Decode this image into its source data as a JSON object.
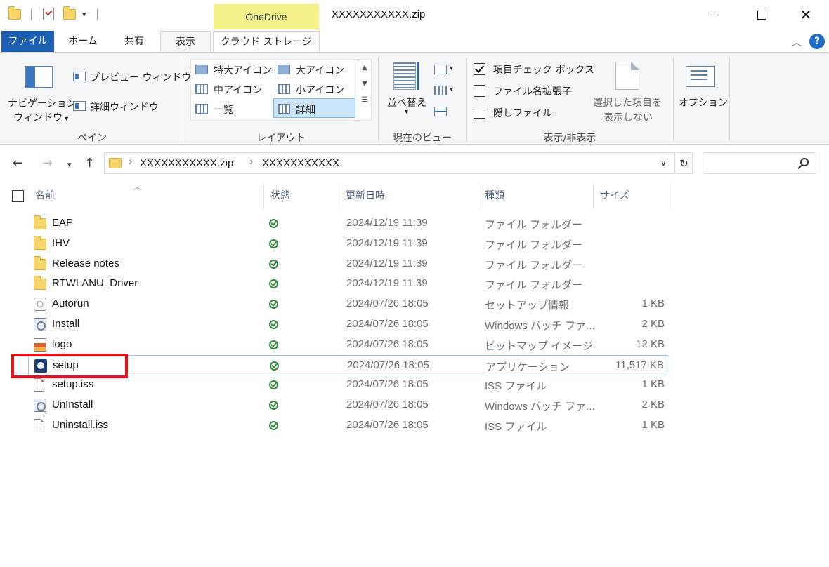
{
  "titlebar": {
    "context_tab": "OneDrive",
    "window_title": "XXXXXXXXXXX.zip",
    "controls": {
      "minimize": "—",
      "maximize": "☐",
      "close": "✕"
    }
  },
  "ribbon_tabs": [
    {
      "label": "ファイル"
    },
    {
      "label": "ホーム"
    },
    {
      "label": "共有"
    },
    {
      "label": "表示"
    },
    {
      "label": "クラウド ストレージ"
    }
  ],
  "ribbon": {
    "pane": {
      "nav_pane_line1": "ナビゲーション",
      "nav_pane_line2": "ウィンドウ",
      "preview_pane": "プレビュー ウィンドウ",
      "details_pane": "詳細ウィンドウ",
      "group_label": "ペイン"
    },
    "layout": {
      "extra_large": "特大アイコン",
      "large": "大アイコン",
      "medium": "中アイコン",
      "small": "小アイコン",
      "list": "一覧",
      "details": "詳細",
      "group_label": "レイアウト"
    },
    "current_view": {
      "sort_by": "並べ替え",
      "group_label": "現在のビュー"
    },
    "show_hide": {
      "item_checkbox": "項目チェック ボックス",
      "item_checkbox_checked": true,
      "file_extensions": "ファイル名拡張子",
      "hidden_items": "隠しファイル",
      "hide_selected_line1": "選択した項目を",
      "hide_selected_line2": "表示しない",
      "group_label": "表示/非表示"
    },
    "options": {
      "label": "オプション"
    }
  },
  "address": {
    "path": [
      "XXXXXXXXXXX.zip",
      "XXXXXXXXXXX"
    ],
    "separator": "›"
  },
  "columns": {
    "name": "名前",
    "status": "状態",
    "modified": "更新日時",
    "type": "種類",
    "size": "サイズ"
  },
  "files": [
    {
      "name": "EAP",
      "icon": "folder-icon",
      "date": "2024/12/19 11:39",
      "type": "ファイル フォルダー",
      "size": ""
    },
    {
      "name": "IHV",
      "icon": "folder-icon",
      "date": "2024/12/19 11:39",
      "type": "ファイル フォルダー",
      "size": ""
    },
    {
      "name": "Release notes",
      "icon": "folder-icon",
      "date": "2024/12/19 11:39",
      "type": "ファイル フォルダー",
      "size": ""
    },
    {
      "name": "RTWLANU_Driver",
      "icon": "folder-icon",
      "date": "2024/12/19 11:39",
      "type": "ファイル フォルダー",
      "size": ""
    },
    {
      "name": "Autorun",
      "icon": "setup-info-icon",
      "date": "2024/07/26 18:05",
      "type": "セットアップ情報",
      "size": "1 KB"
    },
    {
      "name": "Install",
      "icon": "batch-file-icon",
      "date": "2024/07/26 18:05",
      "type": "Windows バッチ ファ...",
      "size": "2 KB"
    },
    {
      "name": "logo",
      "icon": "bitmap-icon",
      "date": "2024/07/26 18:05",
      "type": "ビットマップ イメージ",
      "size": "12 KB"
    },
    {
      "name": "setup",
      "icon": "application-icon",
      "date": "2024/07/26 18:05",
      "type": "アプリケーション",
      "size": "11,517 KB"
    },
    {
      "name": "setup.iss",
      "icon": "document-icon",
      "date": "2024/07/26 18:05",
      "type": "ISS ファイル",
      "size": "1 KB"
    },
    {
      "name": "UnInstall",
      "icon": "batch-file-icon",
      "date": "2024/07/26 18:05",
      "type": "Windows バッチ ファ...",
      "size": "2 KB"
    },
    {
      "name": "Uninstall.iss",
      "icon": "document-icon",
      "date": "2024/07/26 18:05",
      "type": "ISS ファイル",
      "size": "1 KB"
    }
  ],
  "highlighted_file": "setup",
  "colors": {
    "file_tab": "#1e5fb4",
    "context_tab": "#f5f28c",
    "annotation_box": "#e8111b",
    "selection": "#99c9ef"
  }
}
